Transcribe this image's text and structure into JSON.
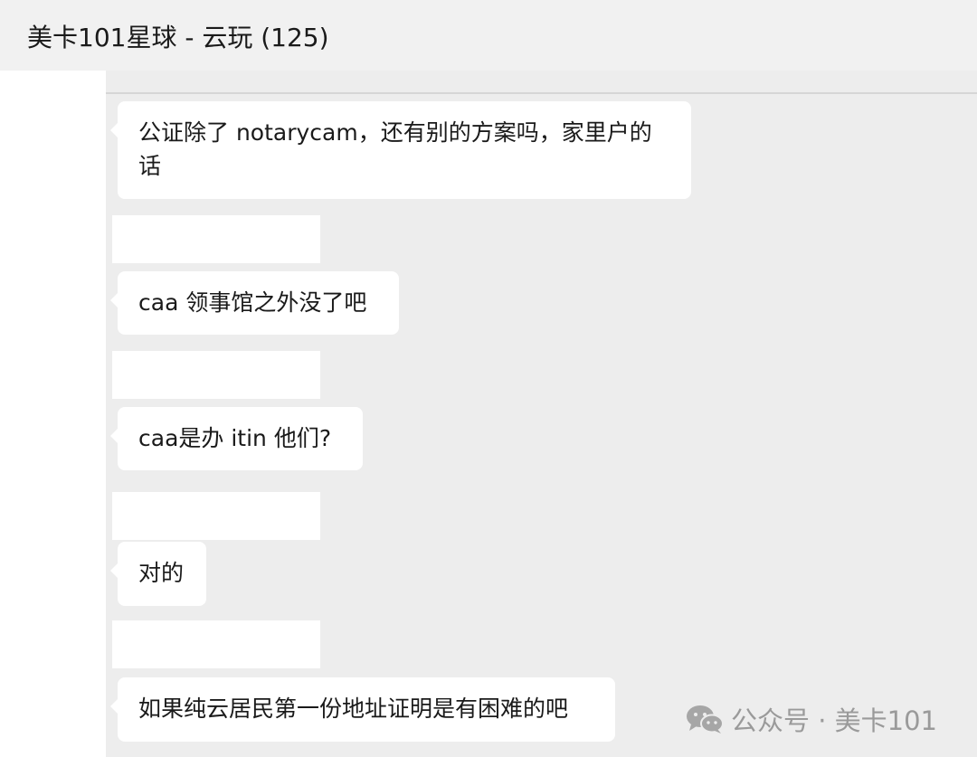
{
  "header": {
    "title": "美卡101星球 - 云玩 (125)"
  },
  "messages": [
    {
      "text": "公证除了 notarycam，还有别的方案吗，家里户的话"
    },
    {
      "text": "caa 领事馆之外没了吧"
    },
    {
      "text": "caa是办 itin 他们?"
    },
    {
      "text": "对的"
    },
    {
      "text": "如果纯云居民第一份地址证明是有困难的吧"
    }
  ],
  "watermark": {
    "icon": "wechat-icon",
    "text": "公众号 · 美卡101"
  },
  "colors": {
    "header_bg": "#f1f1f1",
    "chat_bg": "#ededed",
    "bubble_bg": "#ffffff",
    "text": "#1a1a1a",
    "watermark": "#9a9a9a"
  }
}
